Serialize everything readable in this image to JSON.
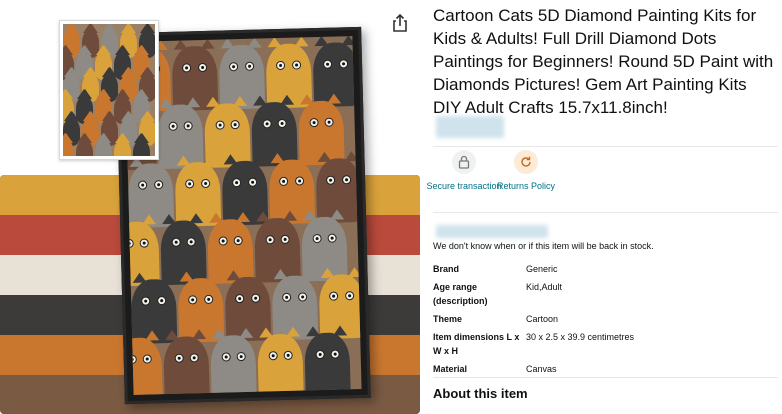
{
  "product": {
    "title": "Cartoon Cats 5D Diamond Painting Kits for Kids & Adults! Full Drill Diamond Dots Paintings for Beginners! Round 5D Paint with Diamonds Pictures! Gem Art Painting Kits DIY Adult Crafts 15.7x11.8inch!"
  },
  "icons": {
    "share": "share-icon",
    "secure": "lock-icon",
    "returns": "return-arrow-icon"
  },
  "badges": [
    {
      "label": "Secure transaction",
      "icon": "lock-icon"
    },
    {
      "label": "Returns Policy",
      "icon": "return-arrow-icon"
    }
  ],
  "availability": "We don't know when or if this item will be back in stock.",
  "specs": [
    {
      "key": "Brand",
      "value": "Generic"
    },
    {
      "key": "Age range (description)",
      "value": "Kid,Adult"
    },
    {
      "key": "Theme",
      "value": "Cartoon"
    },
    {
      "key": "Item dimensions L x W x H",
      "value": "30 x 2.5 x 39.9 centimetres"
    },
    {
      "key": "Material",
      "value": "Canvas"
    }
  ],
  "about_heading": "About this item",
  "colors": {
    "link": "#007185",
    "text": "#0f1111",
    "divider": "#e7e7e7"
  }
}
